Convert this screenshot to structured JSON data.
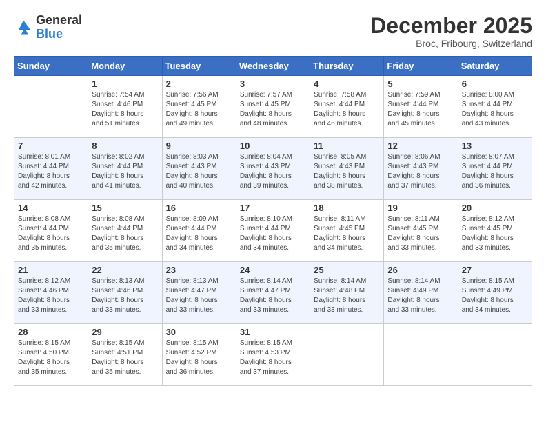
{
  "header": {
    "logo_line1": "General",
    "logo_line2": "Blue",
    "month_title": "December 2025",
    "location": "Broc, Fribourg, Switzerland"
  },
  "days_of_week": [
    "Sunday",
    "Monday",
    "Tuesday",
    "Wednesday",
    "Thursday",
    "Friday",
    "Saturday"
  ],
  "weeks": [
    [
      {
        "day": "",
        "sunrise": "",
        "sunset": "",
        "daylight": ""
      },
      {
        "day": "1",
        "sunrise": "Sunrise: 7:54 AM",
        "sunset": "Sunset: 4:46 PM",
        "daylight": "Daylight: 8 hours and 51 minutes."
      },
      {
        "day": "2",
        "sunrise": "Sunrise: 7:56 AM",
        "sunset": "Sunset: 4:45 PM",
        "daylight": "Daylight: 8 hours and 49 minutes."
      },
      {
        "day": "3",
        "sunrise": "Sunrise: 7:57 AM",
        "sunset": "Sunset: 4:45 PM",
        "daylight": "Daylight: 8 hours and 48 minutes."
      },
      {
        "day": "4",
        "sunrise": "Sunrise: 7:58 AM",
        "sunset": "Sunset: 4:44 PM",
        "daylight": "Daylight: 8 hours and 46 minutes."
      },
      {
        "day": "5",
        "sunrise": "Sunrise: 7:59 AM",
        "sunset": "Sunset: 4:44 PM",
        "daylight": "Daylight: 8 hours and 45 minutes."
      },
      {
        "day": "6",
        "sunrise": "Sunrise: 8:00 AM",
        "sunset": "Sunset: 4:44 PM",
        "daylight": "Daylight: 8 hours and 43 minutes."
      }
    ],
    [
      {
        "day": "7",
        "sunrise": "Sunrise: 8:01 AM",
        "sunset": "Sunset: 4:44 PM",
        "daylight": "Daylight: 8 hours and 42 minutes."
      },
      {
        "day": "8",
        "sunrise": "Sunrise: 8:02 AM",
        "sunset": "Sunset: 4:44 PM",
        "daylight": "Daylight: 8 hours and 41 minutes."
      },
      {
        "day": "9",
        "sunrise": "Sunrise: 8:03 AM",
        "sunset": "Sunset: 4:43 PM",
        "daylight": "Daylight: 8 hours and 40 minutes."
      },
      {
        "day": "10",
        "sunrise": "Sunrise: 8:04 AM",
        "sunset": "Sunset: 4:43 PM",
        "daylight": "Daylight: 8 hours and 39 minutes."
      },
      {
        "day": "11",
        "sunrise": "Sunrise: 8:05 AM",
        "sunset": "Sunset: 4:43 PM",
        "daylight": "Daylight: 8 hours and 38 minutes."
      },
      {
        "day": "12",
        "sunrise": "Sunrise: 8:06 AM",
        "sunset": "Sunset: 4:43 PM",
        "daylight": "Daylight: 8 hours and 37 minutes."
      },
      {
        "day": "13",
        "sunrise": "Sunrise: 8:07 AM",
        "sunset": "Sunset: 4:44 PM",
        "daylight": "Daylight: 8 hours and 36 minutes."
      }
    ],
    [
      {
        "day": "14",
        "sunrise": "Sunrise: 8:08 AM",
        "sunset": "Sunset: 4:44 PM",
        "daylight": "Daylight: 8 hours and 35 minutes."
      },
      {
        "day": "15",
        "sunrise": "Sunrise: 8:08 AM",
        "sunset": "Sunset: 4:44 PM",
        "daylight": "Daylight: 8 hours and 35 minutes."
      },
      {
        "day": "16",
        "sunrise": "Sunrise: 8:09 AM",
        "sunset": "Sunset: 4:44 PM",
        "daylight": "Daylight: 8 hours and 34 minutes."
      },
      {
        "day": "17",
        "sunrise": "Sunrise: 8:10 AM",
        "sunset": "Sunset: 4:44 PM",
        "daylight": "Daylight: 8 hours and 34 minutes."
      },
      {
        "day": "18",
        "sunrise": "Sunrise: 8:11 AM",
        "sunset": "Sunset: 4:45 PM",
        "daylight": "Daylight: 8 hours and 34 minutes."
      },
      {
        "day": "19",
        "sunrise": "Sunrise: 8:11 AM",
        "sunset": "Sunset: 4:45 PM",
        "daylight": "Daylight: 8 hours and 33 minutes."
      },
      {
        "day": "20",
        "sunrise": "Sunrise: 8:12 AM",
        "sunset": "Sunset: 4:45 PM",
        "daylight": "Daylight: 8 hours and 33 minutes."
      }
    ],
    [
      {
        "day": "21",
        "sunrise": "Sunrise: 8:12 AM",
        "sunset": "Sunset: 4:46 PM",
        "daylight": "Daylight: 8 hours and 33 minutes."
      },
      {
        "day": "22",
        "sunrise": "Sunrise: 8:13 AM",
        "sunset": "Sunset: 4:46 PM",
        "daylight": "Daylight: 8 hours and 33 minutes."
      },
      {
        "day": "23",
        "sunrise": "Sunrise: 8:13 AM",
        "sunset": "Sunset: 4:47 PM",
        "daylight": "Daylight: 8 hours and 33 minutes."
      },
      {
        "day": "24",
        "sunrise": "Sunrise: 8:14 AM",
        "sunset": "Sunset: 4:47 PM",
        "daylight": "Daylight: 8 hours and 33 minutes."
      },
      {
        "day": "25",
        "sunrise": "Sunrise: 8:14 AM",
        "sunset": "Sunset: 4:48 PM",
        "daylight": "Daylight: 8 hours and 33 minutes."
      },
      {
        "day": "26",
        "sunrise": "Sunrise: 8:14 AM",
        "sunset": "Sunset: 4:49 PM",
        "daylight": "Daylight: 8 hours and 33 minutes."
      },
      {
        "day": "27",
        "sunrise": "Sunrise: 8:15 AM",
        "sunset": "Sunset: 4:49 PM",
        "daylight": "Daylight: 8 hours and 34 minutes."
      }
    ],
    [
      {
        "day": "28",
        "sunrise": "Sunrise: 8:15 AM",
        "sunset": "Sunset: 4:50 PM",
        "daylight": "Daylight: 8 hours and 35 minutes."
      },
      {
        "day": "29",
        "sunrise": "Sunrise: 8:15 AM",
        "sunset": "Sunset: 4:51 PM",
        "daylight": "Daylight: 8 hours and 35 minutes."
      },
      {
        "day": "30",
        "sunrise": "Sunrise: 8:15 AM",
        "sunset": "Sunset: 4:52 PM",
        "daylight": "Daylight: 8 hours and 36 minutes."
      },
      {
        "day": "31",
        "sunrise": "Sunrise: 8:15 AM",
        "sunset": "Sunset: 4:53 PM",
        "daylight": "Daylight: 8 hours and 37 minutes."
      },
      {
        "day": "",
        "sunrise": "",
        "sunset": "",
        "daylight": ""
      },
      {
        "day": "",
        "sunrise": "",
        "sunset": "",
        "daylight": ""
      },
      {
        "day": "",
        "sunrise": "",
        "sunset": "",
        "daylight": ""
      }
    ]
  ]
}
